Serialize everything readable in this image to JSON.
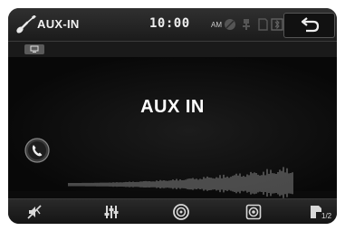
{
  "header": {
    "source_title": "AUX-IN",
    "clock": "10:00",
    "ampm": "AM",
    "status_icons": [
      "disc-icon",
      "usb-icon",
      "sd-card-icon",
      "bluetooth-icon"
    ],
    "back_icon": "back-arrow-icon"
  },
  "subheader": {
    "mode_icon": "screen-mode-icon"
  },
  "main": {
    "title": "AUX IN",
    "phone_icon": "phone-icon"
  },
  "bottom_bar": {
    "items": [
      {
        "name": "mute-icon"
      },
      {
        "name": "equalizer-icon"
      },
      {
        "name": "disc-source-icon"
      },
      {
        "name": "speaker-icon"
      }
    ],
    "page_indicator": "1/2"
  },
  "colors": {
    "background": "#0b0b0b",
    "text": "#ffffff",
    "icon": "#d8d8d8"
  }
}
